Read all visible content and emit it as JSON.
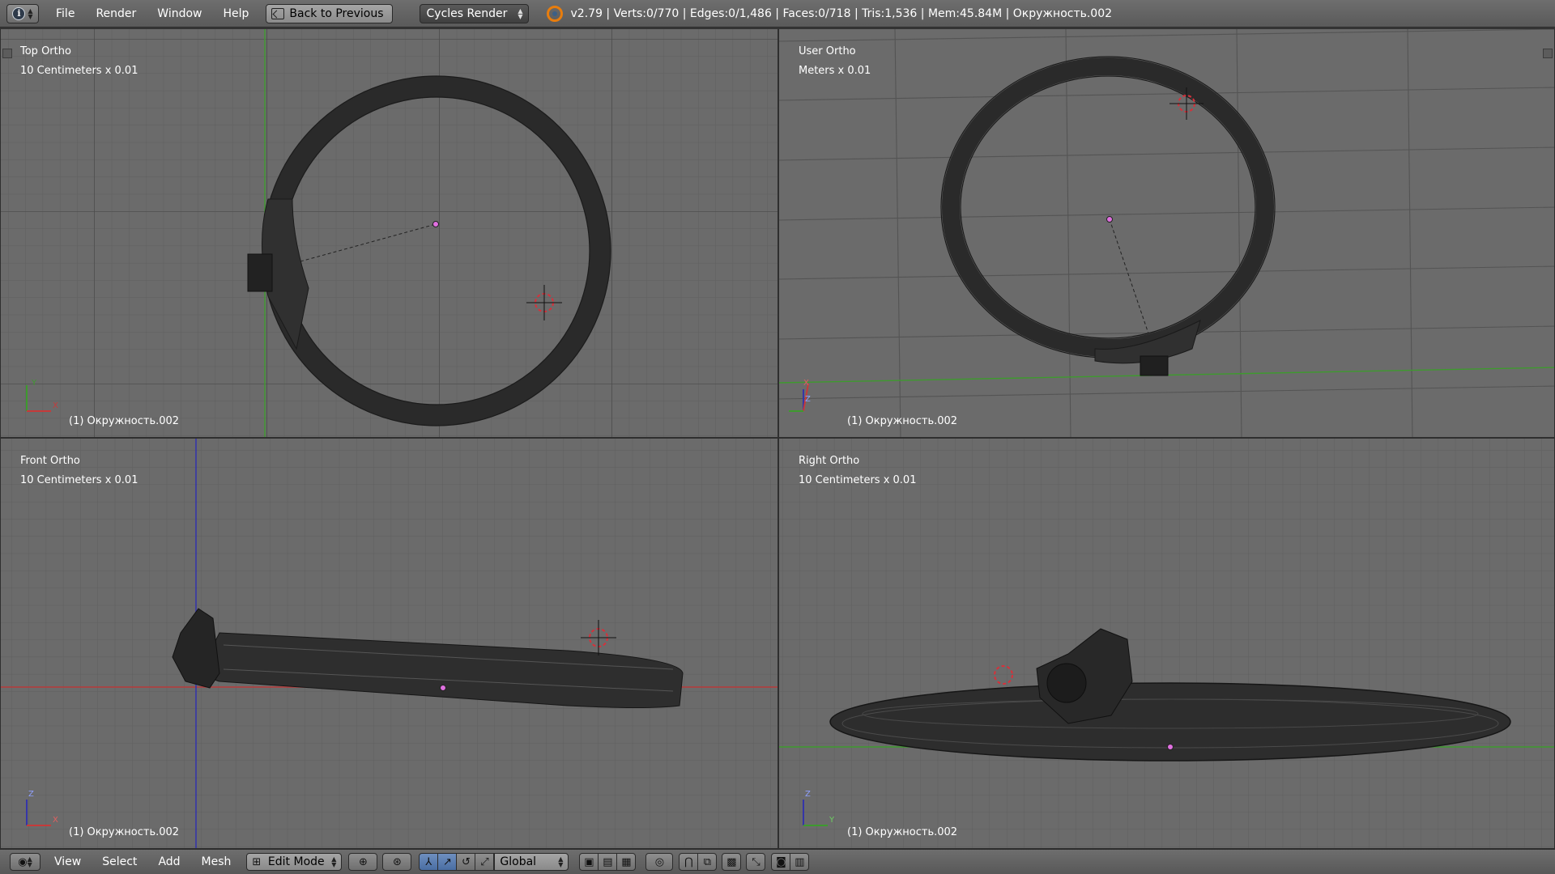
{
  "topbar": {
    "menus": [
      "File",
      "Render",
      "Window",
      "Help"
    ],
    "back_button": "Back to Previous",
    "render_engine": "Cycles Render",
    "stats": "v2.79 | Verts:0/770 | Edges:0/1,486 | Faces:0/718 | Tris:1,536 | Mem:45.84M | Окружность.002"
  },
  "viewports": {
    "top_left": {
      "name": "Top Ortho",
      "scale": "10 Centimeters x 0.01",
      "object": "(1) Окружность.002",
      "axes": [
        "Y",
        "X"
      ]
    },
    "top_right": {
      "name": "User Ortho",
      "scale": "Meters x 0.01",
      "object": "(1) Окружность.002",
      "axes": [
        "Z",
        "X"
      ]
    },
    "bottom_left": {
      "name": "Front Ortho",
      "scale": "10 Centimeters x 0.01",
      "object": "(1) Окружность.002",
      "axes": [
        "Z",
        "X"
      ]
    },
    "bottom_right": {
      "name": "Right Ortho",
      "scale": "10 Centimeters x 0.01",
      "object": "(1) Окружность.002",
      "axes": [
        "Z",
        "Y"
      ]
    }
  },
  "bottombar": {
    "menus": [
      "View",
      "Select",
      "Add",
      "Mesh"
    ],
    "mode": "Edit Mode",
    "orientation": "Global"
  },
  "colors": {
    "viewport_bg": "#6b6b6b",
    "grid_minor": "#5e5e5e",
    "grid_major": "#4f4f4f",
    "axis_green": "#3e9a2e",
    "axis_red": "#b83a3a",
    "axis_blue": "#3535a8",
    "mesh": "#2a2a2a",
    "cursor": "#d8303a",
    "origin": "#e070e0"
  }
}
